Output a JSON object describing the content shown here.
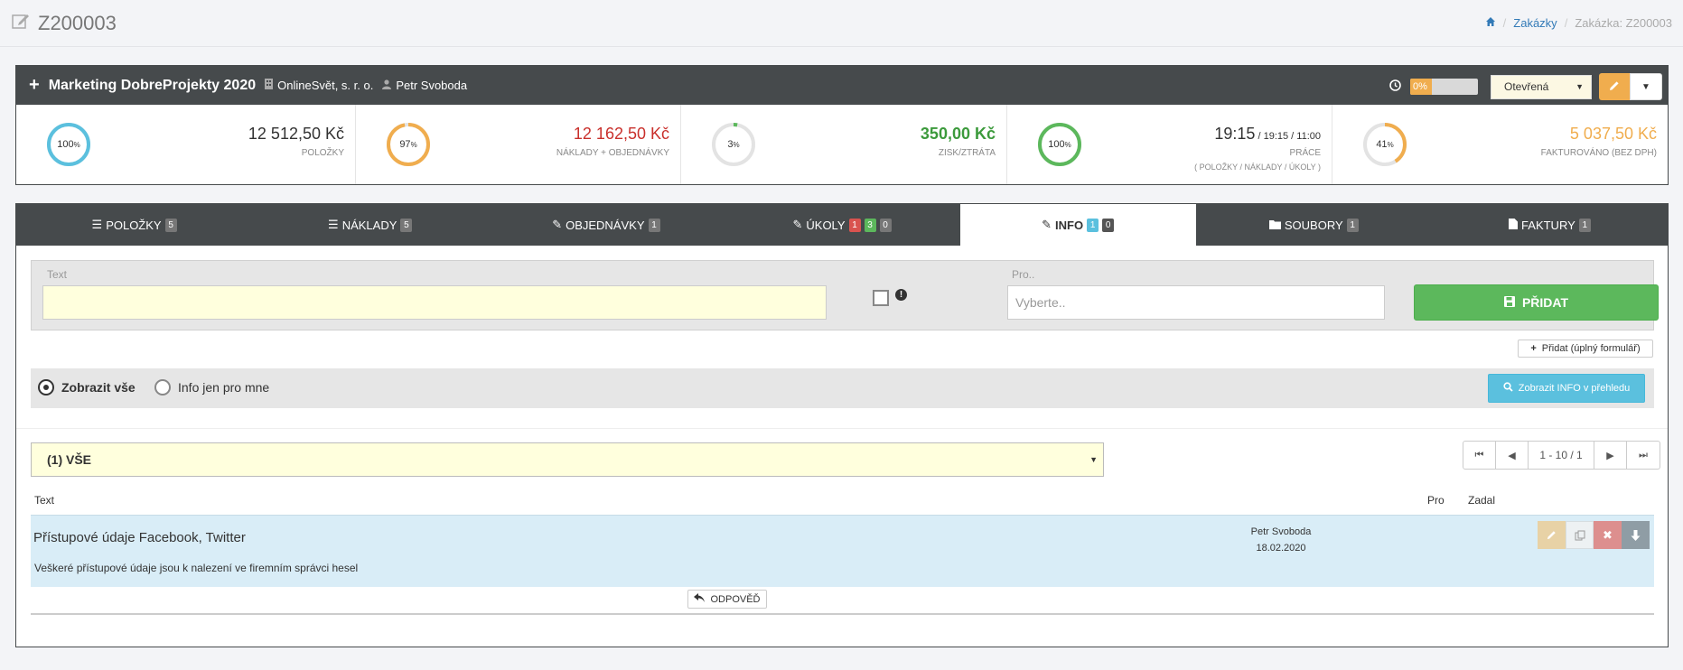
{
  "header": {
    "title": "Z200003",
    "breadcrumb": {
      "link": "Zakázky",
      "current": "Zakázka: Z200003"
    }
  },
  "project": {
    "name": "Marketing DobreProjekty 2020",
    "company": "OnlineSvět, s. r. o.",
    "person": "Petr Svoboda",
    "progress_label": "0%",
    "progress": 0,
    "status": "Otevřená",
    "colors": {
      "header_bg": "#464a4c",
      "warning": "#f0ad4e"
    }
  },
  "stats": [
    {
      "gauge": "100",
      "pct": 100,
      "color": "#5bc0de",
      "amount": "12 512,50 Kč",
      "amount_color": "#333333",
      "label": "POLOŽKY",
      "sub": ""
    },
    {
      "gauge": "97",
      "pct": 97,
      "color": "#f0ad4e",
      "amount": "12 162,50 Kč",
      "amount_color": "#c9302c",
      "label": "NÁKLADY + OBJEDNÁVKY",
      "sub": ""
    },
    {
      "gauge": "3",
      "pct": 3,
      "color": "#5cb85c",
      "amount": "350,00 Kč",
      "amount_color": "#3c9a3c",
      "label": "ZISK/ZTRÁTA",
      "sub": ""
    },
    {
      "gauge": "100",
      "pct": 100,
      "color": "#5cb85c",
      "amount": "19:15",
      "amount_extra": " / 19:15 / 11:00",
      "amount_color": "#333333",
      "label": "PRÁCE",
      "sub": "( POLOŽKY / NÁKLADY / ÚKOLY )"
    },
    {
      "gauge": "41",
      "pct": 41,
      "color": "#f0ad4e",
      "amount": "5 037,50 Kč",
      "amount_color": "#f0ad4e",
      "label": "FAKTUROVÁNO (BEZ DPH)",
      "sub": ""
    }
  ],
  "gauge_suffix": "%",
  "tabs": [
    {
      "label": "POLOŽKY",
      "badges": [
        {
          "v": "5",
          "c": ""
        }
      ]
    },
    {
      "label": "NÁKLADY",
      "badges": [
        {
          "v": "5",
          "c": ""
        }
      ]
    },
    {
      "label": "OBJEDNÁVKY",
      "badges": [
        {
          "v": "1",
          "c": ""
        }
      ]
    },
    {
      "label": "ÚKOLY",
      "badges": [
        {
          "v": "1",
          "c": "red"
        },
        {
          "v": "3",
          "c": "green"
        },
        {
          "v": "0",
          "c": ""
        }
      ]
    },
    {
      "label": "INFO",
      "badges": [
        {
          "v": "1",
          "c": "blue"
        },
        {
          "v": "0",
          "c": "dark"
        }
      ]
    },
    {
      "label": "SOUBORY",
      "badges": [
        {
          "v": "1",
          "c": ""
        }
      ]
    },
    {
      "label": "FAKTURY",
      "badges": [
        {
          "v": "1",
          "c": ""
        }
      ]
    }
  ],
  "form": {
    "text_label": "Text",
    "text_value": "",
    "pro_label": "Pro..",
    "pro_placeholder": "Vyberte..",
    "add_button": "PŘIDAT",
    "full_form_button": "Přidat (úplný formulář)"
  },
  "filter": {
    "show_all": "Zobrazit vše",
    "only_me": "Info jen pro mne",
    "overview_button": "Zobrazit INFO v přehledu"
  },
  "list": {
    "select_value": "(1) VŠE",
    "pager": "1 - 10 / 1",
    "columns": {
      "text": "Text",
      "pro": "Pro",
      "zadal": "Zadal"
    },
    "rows": [
      {
        "title": "Přístupové údaje Facebook, Twitter",
        "description": "Veškeré přístupové údaje jsou k nalezení ve firemním správci hesel",
        "author": "Petr Svoboda",
        "date": "18.02.2020"
      }
    ],
    "reply_button": "ODPOVĚĎ"
  }
}
